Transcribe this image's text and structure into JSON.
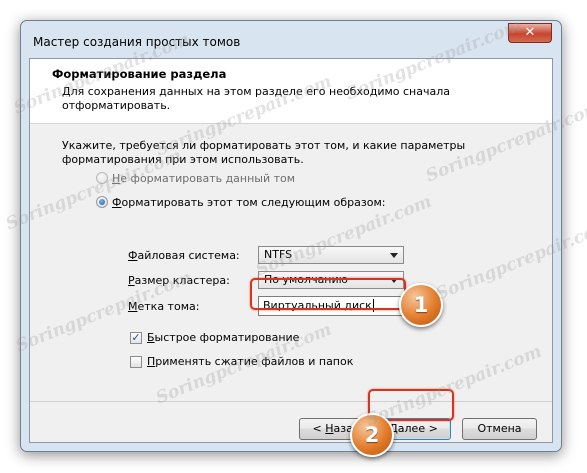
{
  "window": {
    "title": "Мастер создания простых томов",
    "close_glyph": "✕"
  },
  "header": {
    "title": "Форматирование раздела",
    "description": "Для сохранения данных на этом разделе его необходимо сначала отформатировать."
  },
  "instruction": "Укажите, требуется ли форматировать этот том, и какие параметры форматирования при этом использовать.",
  "options": {
    "no_format": {
      "accel": "Н",
      "rest": "е форматировать данный том",
      "checked": false
    },
    "format": {
      "accel": "Ф",
      "rest": "орматировать этот том следующим образом:",
      "checked": true
    }
  },
  "fields": {
    "file_system": {
      "accel": "Ф",
      "rest": "айловая система:",
      "value": "NTFS"
    },
    "cluster_size": {
      "accel": "Р",
      "rest": "азмер кластера:",
      "value": "По умолчанию"
    },
    "volume_label": {
      "accel": "М",
      "rest": "етка тома:",
      "value": "Виртуальный диск"
    }
  },
  "checkboxes": {
    "quick_format": {
      "accel": "Б",
      "rest": "ыстрое форматирование",
      "checked": true,
      "mark": "✓"
    },
    "compression": {
      "accel": "П",
      "rest": "рименять сжатие файлов и папок",
      "checked": false
    }
  },
  "buttons": {
    "back": {
      "prefix": "< ",
      "accel": "Н",
      "rest": "азад"
    },
    "next": {
      "accel": "Д",
      "rest": "алее >"
    },
    "cancel": {
      "label": "Отмена"
    }
  },
  "annotations": {
    "callout_1": "1",
    "callout_2": "2"
  },
  "watermark": "Soringpcrepair.com",
  "colors": {
    "highlight": "#d8331f",
    "callout": "#e27b2a",
    "window_frame": "#d9e4f1",
    "client_bg": "#f0f0f0"
  }
}
